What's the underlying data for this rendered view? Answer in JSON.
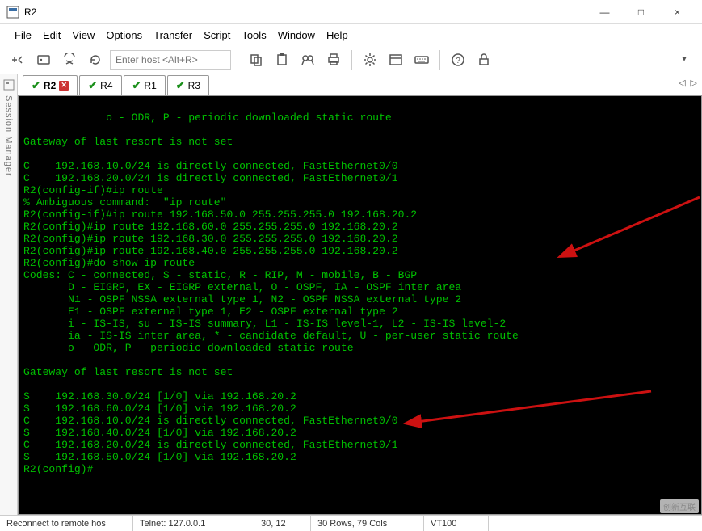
{
  "window": {
    "title": "R2",
    "minimize": "—",
    "maximize": "□",
    "close": "×"
  },
  "menu": {
    "file": "File",
    "edit": "Edit",
    "view": "View",
    "options": "Options",
    "transfer": "Transfer",
    "script": "Script",
    "tools": "Tools",
    "window": "Window",
    "help": "Help"
  },
  "toolbar": {
    "host_placeholder": "Enter host <Alt+R>"
  },
  "left_rail": {
    "label": "Session Manager"
  },
  "tabs": {
    "t0": "R2",
    "t1": "R4",
    "t2": "R1",
    "t3": "R3"
  },
  "terminal_text": "       o - ODR, P - periodic downloaded static route\n\nGateway of last resort is not set\n\nC    192.168.10.0/24 is directly connected, FastEthernet0/0\nC    192.168.20.0/24 is directly connected, FastEthernet0/1\nR2(config-if)#ip route\n% Ambiguous command:  \"ip route\"\nR2(config-if)#ip route 192.168.50.0 255.255.255.0 192.168.20.2\nR2(config)#ip route 192.168.60.0 255.255.255.0 192.168.20.2\nR2(config)#ip route 192.168.30.0 255.255.255.0 192.168.20.2\nR2(config)#ip route 192.168.40.0 255.255.255.0 192.168.20.2\nR2(config)#do show ip route\nCodes: C - connected, S - static, R - RIP, M - mobile, B - BGP\n       D - EIGRP, EX - EIGRP external, O - OSPF, IA - OSPF inter area\n       N1 - OSPF NSSA external type 1, N2 - OSPF NSSA external type 2\n       E1 - OSPF external type 1, E2 - OSPF external type 2\n       i - IS-IS, su - IS-IS summary, L1 - IS-IS level-1, L2 - IS-IS level-2\n       ia - IS-IS inter area, * - candidate default, U - per-user static route\n       o - ODR, P - periodic downloaded static route\n\nGateway of last resort is not set\n\nS    192.168.30.0/24 [1/0] via 192.168.20.2\nS    192.168.60.0/24 [1/0] via 192.168.20.2\nC    192.168.10.0/24 is directly connected, FastEthernet0/0\nS    192.168.40.0/24 [1/0] via 192.168.20.2\nC    192.168.20.0/24 is directly connected, FastEthernet0/1\nS    192.168.50.0/24 [1/0] via 192.168.20.2\nR2(config)#",
  "status": {
    "reconnect": "Reconnect to remote hos",
    "telnet": "Telnet: 127.0.0.1",
    "cursor": "30,  12",
    "size": "30 Rows, 79 Cols",
    "emulation": "VT100"
  },
  "watermark": "创新互联"
}
